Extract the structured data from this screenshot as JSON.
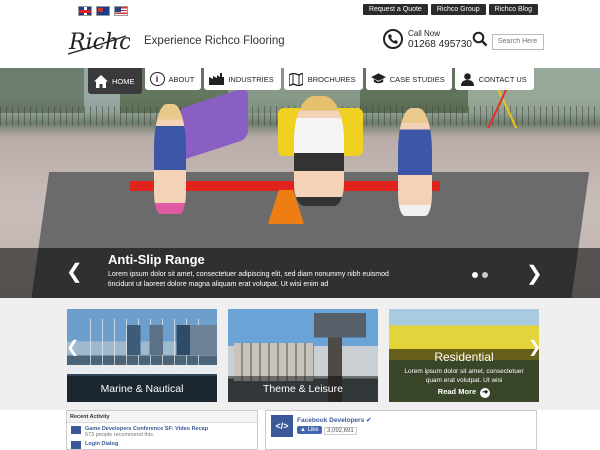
{
  "top_links": [
    "Request a Quote",
    "Richco Group",
    "Richco Blog"
  ],
  "flags": [
    "uk-flag-icon",
    "au-flag-icon",
    "us-flag-icon"
  ],
  "header": {
    "logo_text": "Richco",
    "tagline": "Experience Richco Flooring",
    "call_label": "Call Now",
    "phone": "01268 495730",
    "search_placeholder": "Search Here"
  },
  "nav": [
    {
      "label": "HOME",
      "icon": "home-icon",
      "active": true
    },
    {
      "label": "ABOUT",
      "icon": "info-icon",
      "active": false
    },
    {
      "label": "INDUSTRIES",
      "icon": "factory-icon",
      "active": false
    },
    {
      "label": "BROCHURES",
      "icon": "map-brochure-icon",
      "active": false
    },
    {
      "label": "CASE STUDIES",
      "icon": "graduation-cap-icon",
      "active": false
    },
    {
      "label": "CONTACT US",
      "icon": "person-icon",
      "active": false
    }
  ],
  "hero": {
    "title": "Anti-Slip Range",
    "text": "Lorem ipsum dolor sit amet, consectetuer adipiscing elit, sed diam nonummy nibh euismod tincidunt ut laoreet dolore magna aliquam erat volutpat. Ut wisi enim ad",
    "slide_count": 2,
    "active_slide": 1
  },
  "tiles": [
    {
      "label": "Marine & Nautical"
    },
    {
      "label": "Theme & Leisure"
    },
    {
      "label": "Residential",
      "text": "Lorem ipsum dolor sit amet, consectetuer quam erat volutpat. Ut wisi",
      "more": "Read More"
    }
  ],
  "activity": {
    "heading": "Recent Activity",
    "items": [
      {
        "title": "Game Developers Conference SF: Video Recap",
        "sub": "573 people recommend this."
      },
      {
        "title": "Login Dialog",
        "sub": ""
      }
    ]
  },
  "fb_page": {
    "name": "Facebook Developers",
    "like_label": "Like",
    "like_count": "3,092,691"
  }
}
